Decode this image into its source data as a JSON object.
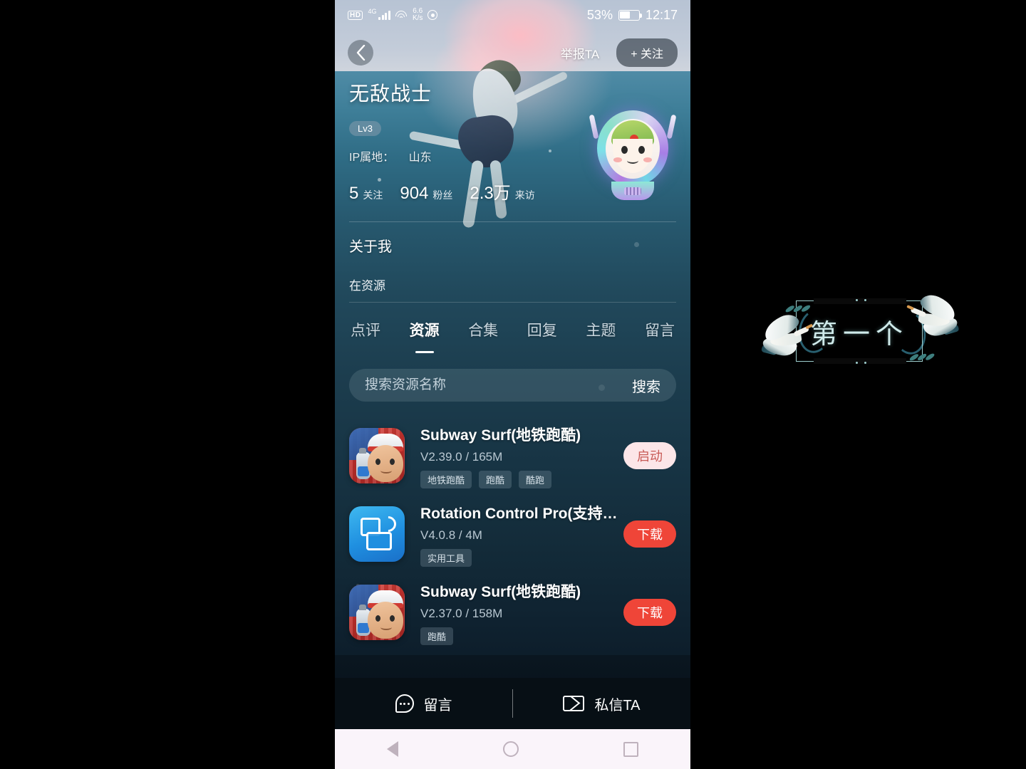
{
  "statusbar": {
    "hd": "HD",
    "network": "4G",
    "speed_value": "6.6",
    "speed_unit": "K/s",
    "battery_percent": "53%",
    "time": "12:17"
  },
  "topnav": {
    "back_icon": "chevron-left-icon",
    "report_label": "举报TA",
    "follow_label": "+ 关注"
  },
  "profile": {
    "username": "无敌战士",
    "level": "Lv3",
    "ip_label": "IP属地：",
    "ip_value": "山东",
    "stats": [
      {
        "num": "5",
        "label": "关注"
      },
      {
        "num": "904",
        "label": "粉丝"
      },
      {
        "num": "2.3万",
        "label": "来访"
      }
    ]
  },
  "about": {
    "title": "关于我",
    "text": "在资源"
  },
  "tabs": [
    {
      "label": "点评",
      "active": false
    },
    {
      "label": "资源",
      "active": true
    },
    {
      "label": "合集",
      "active": false
    },
    {
      "label": "回复",
      "active": false
    },
    {
      "label": "主题",
      "active": false
    },
    {
      "label": "留言",
      "active": false
    }
  ],
  "search": {
    "placeholder": "搜索资源名称",
    "value": "",
    "button_label": "搜索"
  },
  "resources": [
    {
      "icon": "subway-surf-icon",
      "title": "Subway Surf(地铁跑酷)",
      "version": "V2.39.0 / 165M",
      "tags": [
        "地铁跑酷",
        "跑酷",
        "酷跑"
      ],
      "action_label": "启动",
      "action_type": "launch"
    },
    {
      "icon": "rotation-control-icon",
      "title": "Rotation Control Pro(支持地...",
      "version": "V4.0.8 / 4M",
      "tags": [
        "实用工具"
      ],
      "action_label": "下载",
      "action_type": "download"
    },
    {
      "icon": "subway-surf-icon",
      "title": "Subway Surf(地铁跑酷)",
      "version": "V2.37.0 / 158M",
      "tags": [
        "跑酷"
      ],
      "action_label": "下载",
      "action_type": "download"
    }
  ],
  "bottombar": {
    "comment_label": "留言",
    "comment_icon": "comment-bubble-icon",
    "message_label": "私信TA",
    "message_icon": "envelope-icon"
  },
  "navbar": {
    "back_icon": "triangle-back-icon",
    "home_icon": "circle-home-icon",
    "recents_icon": "square-recents-icon"
  },
  "watermark": {
    "text": "第一个"
  },
  "colors": {
    "accent_download": "#ef4538",
    "accent_launch_bg": "#fce6e8",
    "accent_launch_text": "#c85a56",
    "background_dark": "#0b1a26"
  }
}
